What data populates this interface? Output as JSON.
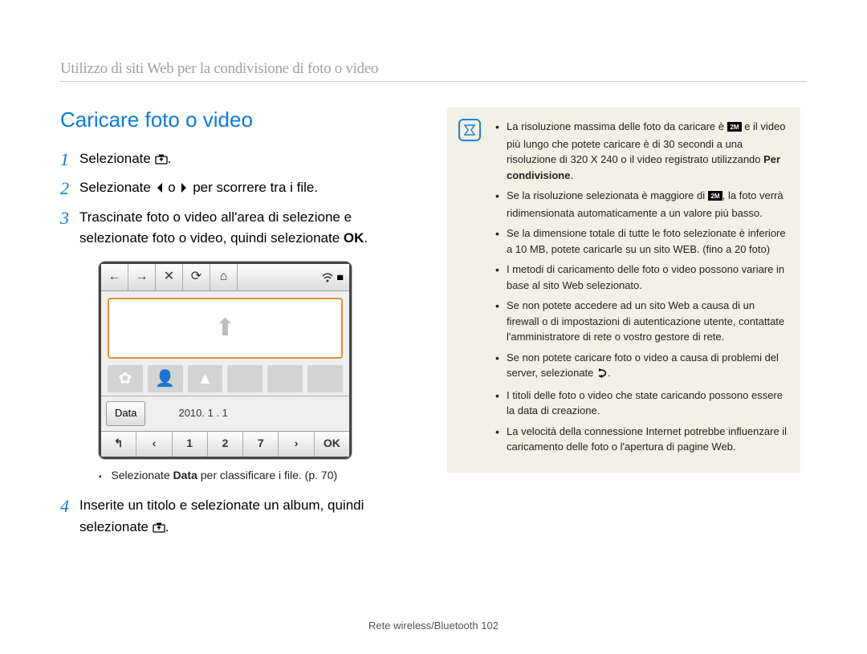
{
  "breadcrumb": "Utilizzo di siti Web per la condivisione di foto o video",
  "section_title": "Caricare foto o video",
  "steps": {
    "s1_a": "Selezionate ",
    "s1_b": ".",
    "s2_a": "Selezionate ",
    "s2_b": " o ",
    "s2_c": " per scorrere tra i file.",
    "s3_a": "Trascinate foto o video all'area di selezione e selezionate foto o video, quindi selezionate ",
    "s3_ok": "OK",
    "s3_b": ".",
    "s4_a": "Inserite un titolo e selezionate un album, quindi selezionate ",
    "s4_b": "."
  },
  "sub_bullet_a": "Selezionate ",
  "sub_bullet_bold": "Data",
  "sub_bullet_b": " per classificare i file. (p. 70)",
  "device": {
    "top_icons": [
      "←",
      "→",
      "✕",
      "⟳",
      "⌂"
    ],
    "signal": "▮▮▮▮",
    "data_label": "Data",
    "date": "2010. 1 . 1",
    "bottom": [
      "↰",
      "‹",
      "1",
      "2",
      "7",
      "›",
      "OK"
    ]
  },
  "notes": {
    "n1_a": "La risoluzione massima delle foto da caricare è ",
    "n1_b": " e il video più lungo che potete caricare è di 30 secondi a una risoluzione di 320 X 240 o il video registrato utilizzando ",
    "n1_bold": "Per condivisione",
    "n1_c": ".",
    "n2_a": "Se la risoluzione selezionata è maggiore di ",
    "n2_b": ", la foto verrà ridimensionata automaticamente a un valore più basso.",
    "n3": "Se la dimensione totale di tutte le foto selezionate è inferiore a 10 MB, potete caricarle su un sito WEB. (fino a 20 foto)",
    "n4": "I metodi di caricamento delle foto o video possono variare in base al sito Web selezionato.",
    "n5": "Se non potete accedere ad un sito Web a causa di un firewall o di impostazioni di autenticazione utente, contattate l'amministratore di rete o vostro gestore di rete.",
    "n6_a": "Se non potete caricare foto o video a causa di problemi del server, selezionate ",
    "n6_b": ".",
    "n7": "I titoli delle foto o video che state caricando possono essere la data di creazione.",
    "n8": "La velocità della connessione Internet potrebbe influenzare il caricamento delle foto o l'apertura di pagine Web."
  },
  "footer_a": "Rete wireless/Bluetooth  ",
  "footer_page": "102"
}
